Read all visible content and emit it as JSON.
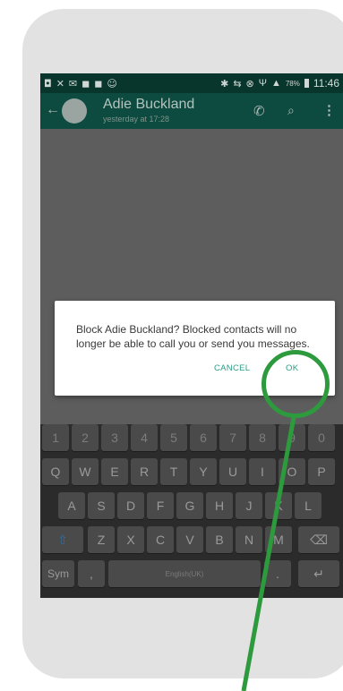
{
  "status_bar": {
    "time": "11:46",
    "battery": "78%",
    "left_icons": [
      "◘",
      "✕",
      "✉",
      "◼",
      "◼",
      "☺"
    ],
    "right_icons": [
      "✱",
      "⇆",
      "⊗",
      "Ψ",
      "▲"
    ]
  },
  "app_bar": {
    "contact_name": "Adie Buckland",
    "last_seen": "yesterday at 17:28",
    "back_glyph": "←",
    "call_glyph": "✆",
    "attach_glyph": "⌕",
    "more_glyph": "⋮"
  },
  "dialog": {
    "message": "Block Adie Buckland? Blocked contacts will no longer be able to call you or send you messages.",
    "cancel_label": "CANCEL",
    "ok_label": "OK"
  },
  "keyboard": {
    "row_numbers": [
      "1",
      "2",
      "3",
      "4",
      "5",
      "6",
      "7",
      "8",
      "9",
      "0"
    ],
    "row_1": [
      "Q",
      "W",
      "E",
      "R",
      "T",
      "Y",
      "U",
      "I",
      "O",
      "P"
    ],
    "row_2": [
      "A",
      "S",
      "D",
      "F",
      "G",
      "H",
      "J",
      "K",
      "L"
    ],
    "row_3": [
      "Z",
      "X",
      "C",
      "V",
      "B",
      "N",
      "M"
    ],
    "shift_glyph": "⇧",
    "backspace_glyph": "⌫",
    "sym_label": "Sym",
    "comma_label": ",",
    "space_label": "English(UK)",
    "period_label": ".",
    "enter_glyph": "↵"
  },
  "colors": {
    "highlight": "#2d9a3e",
    "accent": "#2a9d86",
    "app_bar": "#0d4a3f"
  }
}
